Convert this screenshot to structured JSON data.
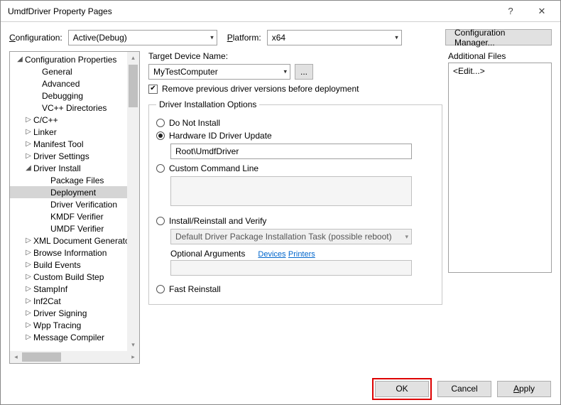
{
  "window": {
    "title": "UmdfDriver Property Pages"
  },
  "toprow": {
    "configuration_label": "Configuration:",
    "configuration_value": "Active(Debug)",
    "platform_label": "Platform:",
    "platform_value": "x64",
    "manager_button": "Configuration Manager..."
  },
  "tree": {
    "items": [
      {
        "label": "Configuration Properties",
        "indent": 0,
        "arrow": "◢"
      },
      {
        "label": "General",
        "indent": 2,
        "arrow": ""
      },
      {
        "label": "Advanced",
        "indent": 2,
        "arrow": ""
      },
      {
        "label": "Debugging",
        "indent": 2,
        "arrow": ""
      },
      {
        "label": "VC++ Directories",
        "indent": 2,
        "arrow": ""
      },
      {
        "label": "C/C++",
        "indent": 1,
        "arrow": "▷"
      },
      {
        "label": "Linker",
        "indent": 1,
        "arrow": "▷"
      },
      {
        "label": "Manifest Tool",
        "indent": 1,
        "arrow": "▷"
      },
      {
        "label": "Driver Settings",
        "indent": 1,
        "arrow": "▷"
      },
      {
        "label": "Driver Install",
        "indent": 1,
        "arrow": "◢"
      },
      {
        "label": "Package Files",
        "indent": 3,
        "arrow": ""
      },
      {
        "label": "Deployment",
        "indent": 3,
        "arrow": "",
        "selected": true
      },
      {
        "label": "Driver Verification",
        "indent": 3,
        "arrow": ""
      },
      {
        "label": "KMDF Verifier",
        "indent": 3,
        "arrow": ""
      },
      {
        "label": "UMDF Verifier",
        "indent": 3,
        "arrow": ""
      },
      {
        "label": "XML Document Generator",
        "indent": 1,
        "arrow": "▷"
      },
      {
        "label": "Browse Information",
        "indent": 1,
        "arrow": "▷"
      },
      {
        "label": "Build Events",
        "indent": 1,
        "arrow": "▷"
      },
      {
        "label": "Custom Build Step",
        "indent": 1,
        "arrow": "▷"
      },
      {
        "label": "StampInf",
        "indent": 1,
        "arrow": "▷"
      },
      {
        "label": "Inf2Cat",
        "indent": 1,
        "arrow": "▷"
      },
      {
        "label": "Driver Signing",
        "indent": 1,
        "arrow": "▷"
      },
      {
        "label": "Wpp Tracing",
        "indent": 1,
        "arrow": "▷"
      },
      {
        "label": "Message Compiler",
        "indent": 1,
        "arrow": "▷"
      }
    ]
  },
  "main": {
    "target_label": "Target Device Name:",
    "target_value": "MyTestComputer",
    "browse_label": "...",
    "remove_checkbox_label": "Remove previous driver versions before deployment",
    "remove_checkbox_checked": true,
    "install_options_legend": "Driver Installation Options",
    "radios": {
      "do_not_install": "Do Not Install",
      "hw_id_update": "Hardware ID Driver Update",
      "hw_id_value": "Root\\UmdfDriver",
      "custom_cmd": "Custom Command Line",
      "install_verify": "Install/Reinstall and Verify",
      "install_task": "Default Driver Package Installation Task (possible reboot)",
      "optional_args": "Optional Arguments",
      "devices_link": "Devices",
      "printers_link": "Printers",
      "fast_reinstall": "Fast Reinstall"
    },
    "additional_files_label": "Additional Files",
    "additional_files_value": "<Edit...>"
  },
  "footer": {
    "ok": "OK",
    "cancel": "Cancel",
    "apply": "Apply"
  }
}
